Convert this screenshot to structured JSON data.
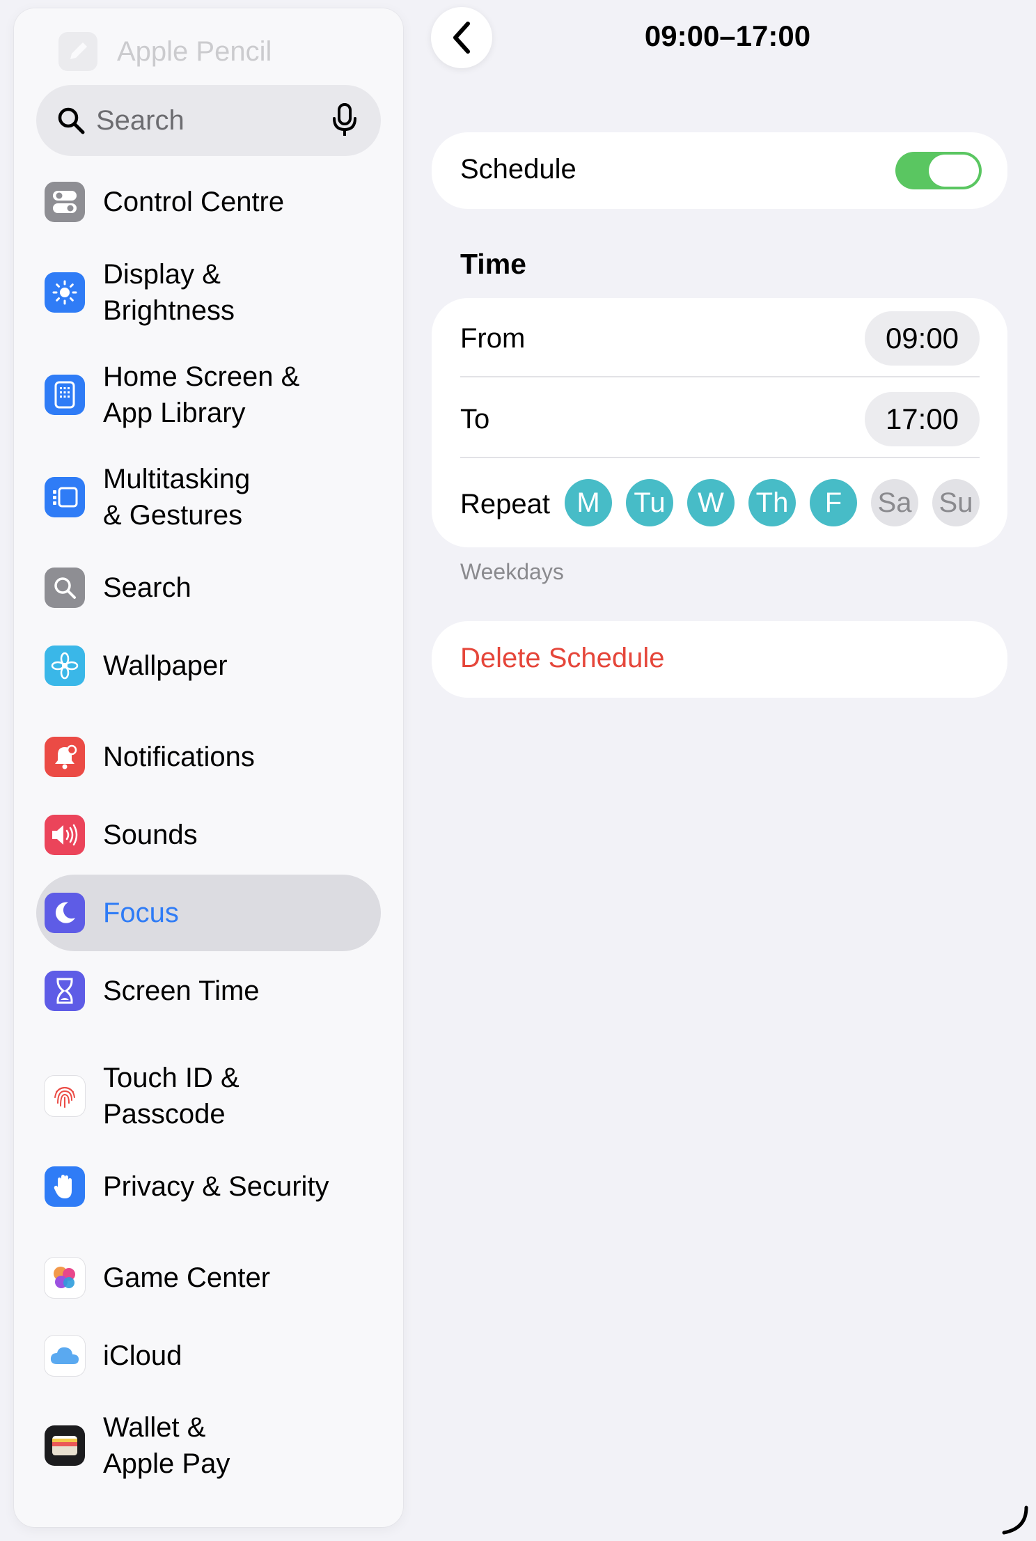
{
  "sidebar": {
    "faded_item": "Apple Pencil",
    "search_placeholder": "Search",
    "items": [
      {
        "label": "Control Centre",
        "icon": "switches-icon",
        "color": "#8e8e93"
      },
      {
        "label": "Display &\nBrightness",
        "icon": "sun-icon",
        "color": "#2f7cf6"
      },
      {
        "label": "Home Screen &\nApp Library",
        "icon": "phone-grid-icon",
        "color": "#2f7cf6"
      },
      {
        "label": "Multitasking\n& Gestures",
        "icon": "multitasking-icon",
        "color": "#2f7cf6"
      },
      {
        "label": "Search",
        "icon": "magnifier-icon",
        "color": "#8e8e93"
      },
      {
        "label": "Wallpaper",
        "icon": "flower-icon",
        "color": "#3ab7e8"
      },
      {
        "label": "Notifications",
        "icon": "bell-icon",
        "color": "#eb4b45"
      },
      {
        "label": "Sounds",
        "icon": "speaker-icon",
        "color": "#eb445a"
      },
      {
        "label": "Focus",
        "icon": "moon-icon",
        "color": "#5e5ce6",
        "selected": true
      },
      {
        "label": "Screen Time",
        "icon": "hourglass-icon",
        "color": "#5e5ce6"
      },
      {
        "label": "Touch ID &\nPasscode",
        "icon": "fingerprint-icon",
        "color": "#ffffff"
      },
      {
        "label": "Privacy & Security",
        "icon": "hand-icon",
        "color": "#2f7cf6"
      },
      {
        "label": "Game Center",
        "icon": "game-center-icon",
        "color": "#ffffff"
      },
      {
        "label": "iCloud",
        "icon": "cloud-icon",
        "color": "#ffffff"
      },
      {
        "label": "Wallet &\nApple Pay",
        "icon": "wallet-icon",
        "color": "#1c1c1e"
      }
    ]
  },
  "main": {
    "title": "09:00–17:00",
    "schedule": {
      "label": "Schedule",
      "enabled": true
    },
    "time_section": {
      "header": "Time",
      "from_label": "From",
      "from_value": "09:00",
      "to_label": "To",
      "to_value": "17:00",
      "repeat_label": "Repeat",
      "days": [
        {
          "label": "M",
          "on": true
        },
        {
          "label": "Tu",
          "on": true
        },
        {
          "label": "W",
          "on": true
        },
        {
          "label": "Th",
          "on": true
        },
        {
          "label": "F",
          "on": true
        },
        {
          "label": "Sa",
          "on": false
        },
        {
          "label": "Su",
          "on": false
        }
      ],
      "footer": "Weekdays"
    },
    "delete_label": "Delete Schedule"
  },
  "colors": {
    "accent": "#2f7cf6",
    "toggle_on": "#5ac661",
    "day_on": "#47bcc7",
    "destructive": "#e5463a"
  }
}
